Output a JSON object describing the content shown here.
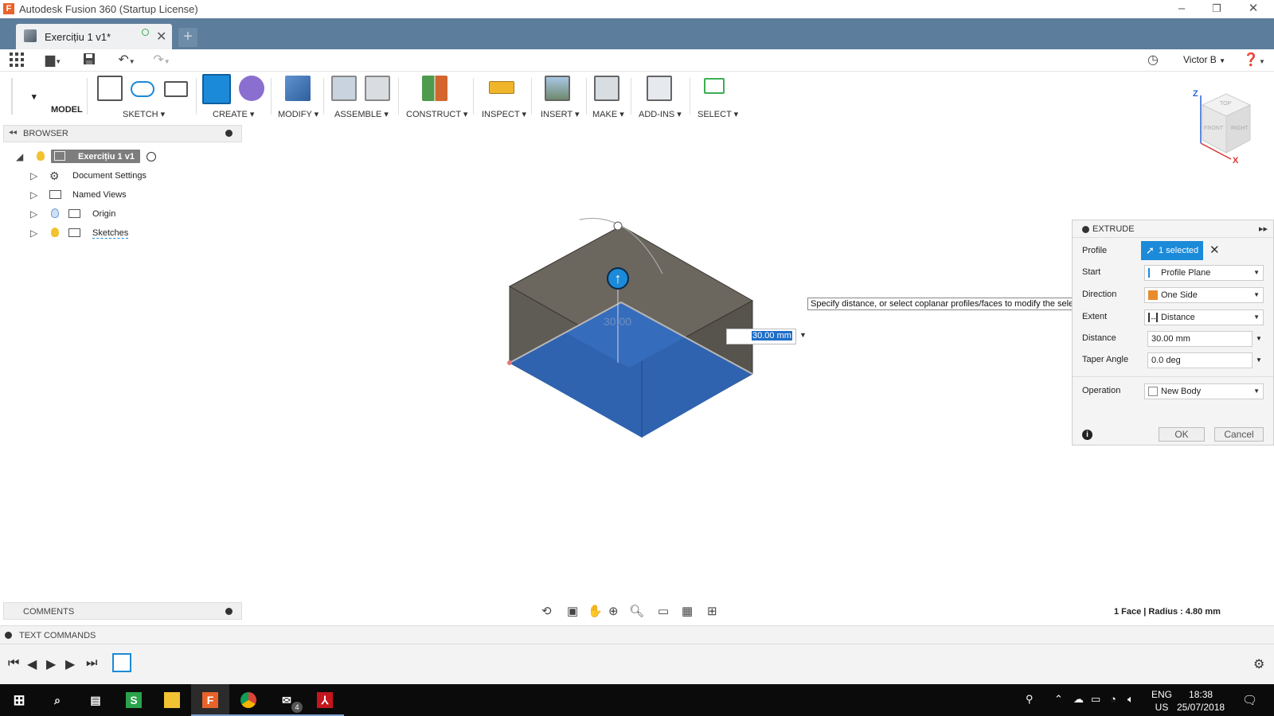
{
  "window": {
    "title": "Autodesk Fusion 360 (Startup License)",
    "app_icon_letter": "F"
  },
  "document_tab": {
    "label": "Exercițiu 1 v1*"
  },
  "quick_access": {
    "user": "Victor B"
  },
  "toolbar": {
    "workspace": "MODEL",
    "groups": [
      "SKETCH",
      "CREATE",
      "MODIFY",
      "ASSEMBLE",
      "CONSTRUCT",
      "INSPECT",
      "INSERT",
      "MAKE",
      "ADD-INS",
      "SELECT"
    ]
  },
  "browser": {
    "title": "BROWSER",
    "root": "Exercițiu 1 v1",
    "items": [
      "Document Settings",
      "Named Views",
      "Origin",
      "Sketches"
    ]
  },
  "viewport": {
    "tooltip": "Specify distance, or select coplanar profiles/faces to modify the selection",
    "inline_distance": "30.00 mm",
    "ghost_dimension": "30.00",
    "viewcube_faces": [
      "TOP",
      "FRONT",
      "RIGHT"
    ],
    "axis_labels": [
      "Z",
      "X"
    ]
  },
  "extrude": {
    "title": "EXTRUDE",
    "profile_label": "Profile",
    "profile_value": "1 selected",
    "start_label": "Start",
    "start_value": "Profile Plane",
    "direction_label": "Direction",
    "direction_value": "One Side",
    "extent_label": "Extent",
    "extent_value": "Distance",
    "distance_label": "Distance",
    "distance_value": "30.00 mm",
    "taper_label": "Taper Angle",
    "taper_value": "0.0 deg",
    "operation_label": "Operation",
    "operation_value": "New Body",
    "ok": "OK",
    "cancel": "Cancel"
  },
  "bottom": {
    "comments": "COMMENTS",
    "status": "1 Face | Radius : 4.80 mm",
    "text_commands": "TEXT COMMANDS"
  },
  "taskbar": {
    "lang_top": "ENG",
    "lang_bottom": "US",
    "time": "18:38",
    "date": "25/07/2018",
    "mail_badge": "4"
  },
  "colors": {
    "accent": "#1b8ad8",
    "tab_strip": "#5c7d9c",
    "face_blue": "#2f63b0",
    "box_gray": "#6b665e"
  }
}
